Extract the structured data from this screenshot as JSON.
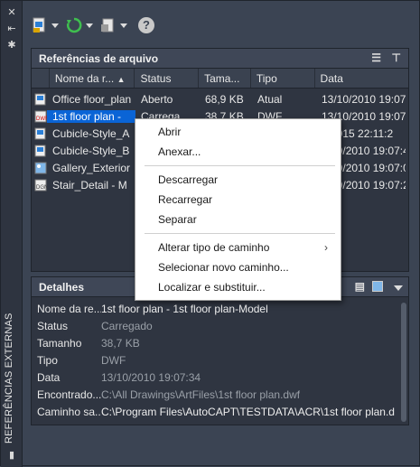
{
  "palette": {
    "title": "REFERÊNCIAS EXTERNAS"
  },
  "toolbar": {
    "buttons": [
      "attach-dwg-icon",
      "refresh-icon",
      "change-path-icon",
      "help-icon"
    ],
    "help_label": "?"
  },
  "file_refs": {
    "title": "Referências de arquivo",
    "columns": [
      "Nome da r...",
      "Status",
      "Tama...",
      "Tipo",
      "Data"
    ],
    "rows": [
      {
        "name": "Office floor_plan",
        "status": "Aberto",
        "size": "68,9 KB",
        "type": "Atual",
        "date": "13/10/2010 19:07:1",
        "icon": "dwg"
      },
      {
        "name": "1st floor plan -",
        "status": "Carrega...",
        "size": "38,7 KB",
        "type": "DWF",
        "date": "13/10/2010 19:07:3",
        "icon": "dwf"
      },
      {
        "name": "Cubicle-Style_A",
        "status": "",
        "size": "",
        "type": "",
        "date": "2/2015 22:11:2",
        "icon": "dwg"
      },
      {
        "name": "Cubicle-Style_B",
        "status": "",
        "size": "",
        "type": "",
        "date": "3/10/2010 19:07:4",
        "icon": "dwg"
      },
      {
        "name": "Gallery_Exterior",
        "status": "",
        "size": "",
        "type": "",
        "date": "3/10/2010 19:07:0",
        "icon": "img"
      },
      {
        "name": "Stair_Detail - M",
        "status": "",
        "size": "",
        "type": "",
        "date": "3/10/2010 19:07:2",
        "icon": "dgn"
      }
    ]
  },
  "context_menu": {
    "items": [
      {
        "label": "Abrir"
      },
      {
        "label": "Anexar..."
      },
      {
        "sep": true
      },
      {
        "label": "Descarregar"
      },
      {
        "label": "Recarregar"
      },
      {
        "label": "Separar"
      },
      {
        "sep": true
      },
      {
        "label": "Alterar tipo de caminho",
        "submenu": true
      },
      {
        "label": "Selecionar novo caminho..."
      },
      {
        "label": "Localizar e substituir..."
      }
    ],
    "submenu_glyph": "›"
  },
  "details": {
    "title": "Detalhes",
    "rows": [
      {
        "label": "Nome da re...",
        "value": "1st floor plan - 1st floor plan-Model",
        "bright": true
      },
      {
        "label": "Status",
        "value": "Carregado"
      },
      {
        "label": "Tamanho",
        "value": "38,7 KB"
      },
      {
        "label": "Tipo",
        "value": "DWF"
      },
      {
        "label": "Data",
        "value": "13/10/2010 19:07:34"
      },
      {
        "label": "Encontrado...",
        "value": "C:\\All Drawings\\ArtFiles\\1st floor plan.dwf"
      },
      {
        "label": "Caminho sa...",
        "value": "C:\\Program Files\\AutoCAPT\\TESTDATA\\ACR\\1st floor plan.d",
        "bright": true
      }
    ]
  },
  "colors": {
    "selection": "#0a64d6",
    "panel": "#2f3541",
    "accent_green": "#3fbf4f"
  }
}
